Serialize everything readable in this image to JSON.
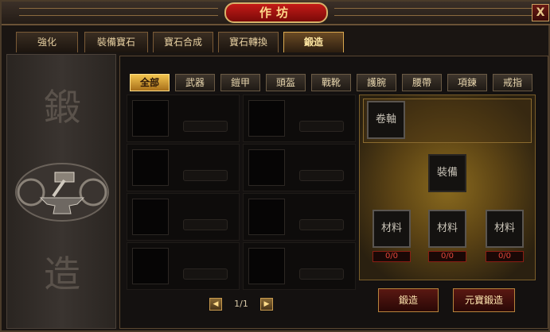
{
  "window": {
    "title": "作坊",
    "close_label": "X"
  },
  "main_tabs": [
    {
      "label": "強化"
    },
    {
      "label": "裝備寶石"
    },
    {
      "label": "寶石合成"
    },
    {
      "label": "寶石轉換"
    },
    {
      "label": "鍛造",
      "active": true
    }
  ],
  "side_panel": {
    "char_top": "鍛",
    "char_bottom": "造"
  },
  "sub_tabs": [
    {
      "label": "全部",
      "active": true
    },
    {
      "label": "武器"
    },
    {
      "label": "鎧甲"
    },
    {
      "label": "頭盔"
    },
    {
      "label": "戰靴"
    },
    {
      "label": "護腕"
    },
    {
      "label": "腰帶"
    },
    {
      "label": "項鍊"
    },
    {
      "label": "戒指"
    }
  ],
  "pager": {
    "text": "1/1",
    "prev_icon": "triangle-left-icon",
    "next_icon": "triangle-right-icon"
  },
  "forge": {
    "scroll_label": "卷軸",
    "equipment_label": "裝備",
    "materials": [
      {
        "label": "材料",
        "count": "0/0"
      },
      {
        "label": "材料",
        "count": "0/0"
      },
      {
        "label": "材料",
        "count": "0/0"
      }
    ]
  },
  "actions": {
    "forge_label": "鍛造",
    "ingot_forge_label": "元寶鍛造"
  },
  "colors": {
    "accent_gold": "#f2c44e",
    "title_red": "#c41b17",
    "count_red": "#e0463a"
  }
}
